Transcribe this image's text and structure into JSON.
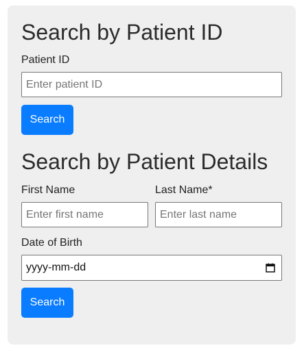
{
  "patient_id_section": {
    "heading": "Search by Patient ID",
    "field_label": "Patient ID",
    "field_placeholder": "Enter patient ID",
    "field_value": "",
    "search_label": "Search"
  },
  "details_section": {
    "heading": "Search by Patient Details",
    "first_name_label": "First Name",
    "first_name_placeholder": "Enter first name",
    "last_name_label": "Last Name*",
    "last_name_placeholder": "Enter last name",
    "dob_label": "Date of Birth",
    "dob_value": "yyyy-mm-dd",
    "calendar_icon": "calendar-icon",
    "search_label": "Search"
  },
  "colors": {
    "panel_background": "#efefef",
    "button_primary": "#0a7cff",
    "button_text": "#ffffff"
  }
}
